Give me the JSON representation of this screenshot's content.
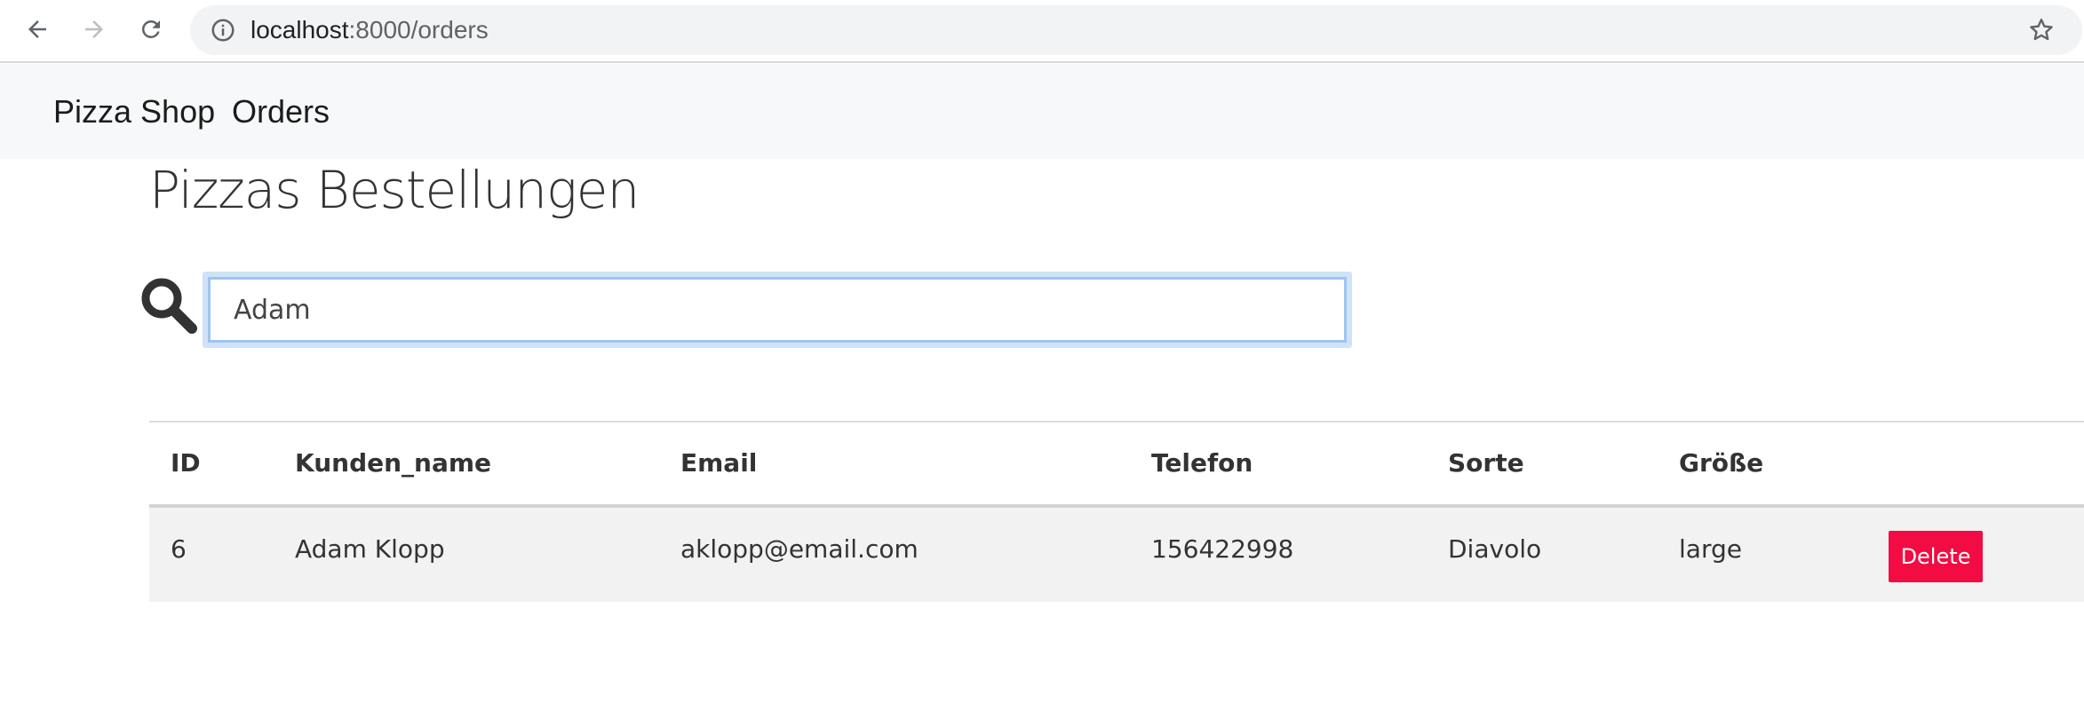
{
  "browser": {
    "url_host": "localhost",
    "url_path": ":8000/orders"
  },
  "navbar": {
    "brand": "Pizza Shop",
    "links": [
      "Orders"
    ]
  },
  "page": {
    "title": "Pizzas Bestellungen"
  },
  "search": {
    "value": "Adam"
  },
  "table": {
    "headers": [
      "ID",
      "Kunden_name",
      "Email",
      "Telefon",
      "Sorte",
      "Größe",
      ""
    ],
    "rows": [
      {
        "id": "6",
        "name": "Adam Klopp",
        "email": "aklopp@email.com",
        "phone": "156422998",
        "sorte": "Diavolo",
        "size": "large",
        "action": "Delete"
      }
    ]
  },
  "colors": {
    "delete_button": "#f20c43",
    "navbar_bg": "#f7f8f9",
    "focus_border": "#9dc5ee"
  }
}
